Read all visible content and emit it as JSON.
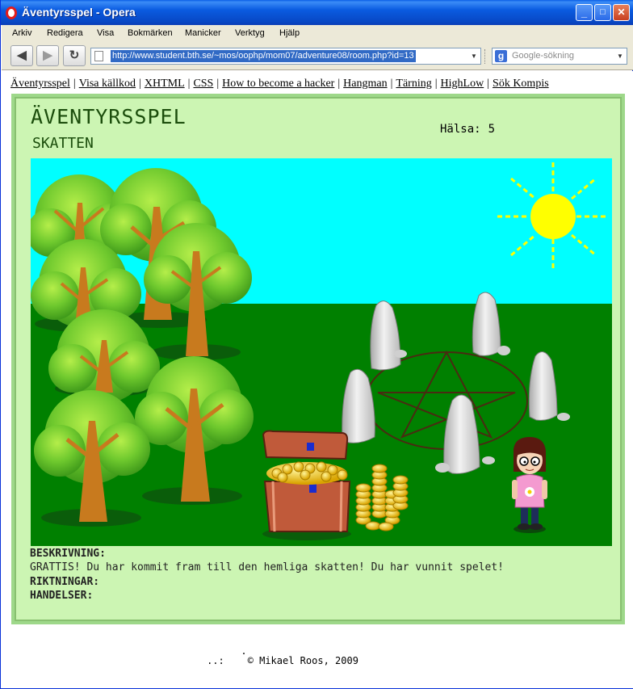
{
  "window": {
    "title": "Äventyrsspel - Opera",
    "minimize": "_",
    "maximize": "□",
    "close": "✕"
  },
  "menu": [
    "Arkiv",
    "Redigera",
    "Visa",
    "Bokmärken",
    "Manicker",
    "Verktyg",
    "Hjälp"
  ],
  "toolbar": {
    "back_icon": "◀",
    "forward_icon": "▶",
    "reload_icon": "↻",
    "url": "http://www.student.bth.se/~mos/oophp/mom07/adventure08/room.php?id=13",
    "search_placeholder": "Google-sökning",
    "dropdown_icon": "▼",
    "search_engine_icon": "g"
  },
  "nav_links": [
    "Äventyrsspel",
    "Visa källkod",
    "XHTML",
    "CSS",
    "How to become a hacker",
    "Hangman",
    "Tärning",
    "HighLow",
    "Sök Kompis"
  ],
  "game": {
    "title": "ÄVENTYRSSPEL",
    "room": "SKATTEN",
    "health_label": "Hälsa:",
    "health_value": "5",
    "description_label": "BESKRIVNING:",
    "description": "GRATTIS! Du har kommit fram till den hemliga skatten! Du har vunnit spelet!",
    "directions_label": "RIKTNINGAR:",
    "events_label": "HANDELSER:"
  },
  "footer": {
    "dot": ".",
    "symbol": "..:",
    "copyright": "© Mikael Roos, 2009"
  },
  "colors": {
    "sky": "#00ffff",
    "grass": "#008000",
    "sun": "#ffff00",
    "panel": "#ccf5b3",
    "title_text": "#1b4d0c"
  }
}
